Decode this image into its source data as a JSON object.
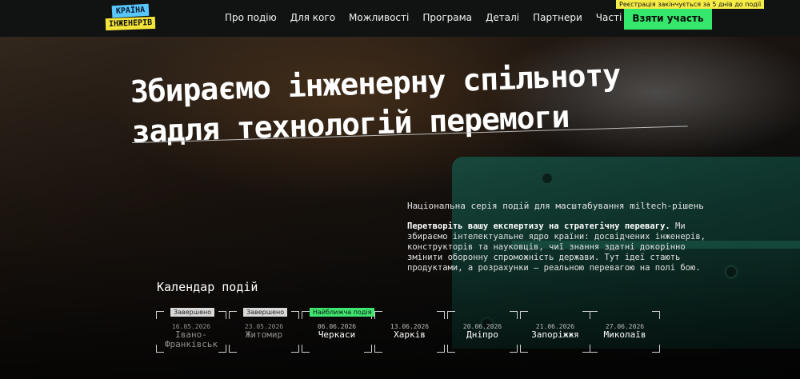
{
  "header": {
    "logo_line1": "КРАЇНА",
    "logo_line2": "ІНЖЕНЕРІВ",
    "nav": [
      "Про подію",
      "Для кого",
      "Можливості",
      "Програма",
      "Деталі",
      "Партнери",
      "Часті питання"
    ],
    "cta_label": "Взяти участь",
    "cta_tip": "Реєстрація закінчується за 5 днів до події"
  },
  "hero": {
    "title_line1": "Збираємо інженерну спільноту",
    "title_line2": "задля технологій перемоги",
    "subtitle": "Національна серія подій для масштабування miltech-рішень",
    "desc_bold": "Перетворіть вашу експертизу на стратегічну перевагу.",
    "desc_rest": " Ми збираємо інтелектуальне ядро країни: досвідчених інженерів, конструкторів та науковців, чиї знання здатні докорінно змінити оборонну спроможність держави. Тут ідеї стають продуктами, а розрахунки – реальною перевагою на полі бою."
  },
  "calendar": {
    "title": "Календар подій",
    "events": [
      {
        "badge": "Завершено",
        "date": "16.05.2026",
        "city": "Івано-Франківськ",
        "status": "done"
      },
      {
        "badge": "Завершено",
        "date": "23.05.2026",
        "city": "Житомир",
        "status": "done"
      },
      {
        "badge": "Найближча подія",
        "date": "06.06.2026",
        "city": "Черкаси",
        "status": "next"
      },
      {
        "badge": "",
        "date": "13.06.2026",
        "city": "Харків",
        "status": "upcoming"
      },
      {
        "badge": "",
        "date": "20.06.2026",
        "city": "Дніпро",
        "status": "upcoming"
      },
      {
        "badge": "",
        "date": "21.06.2026",
        "city": "Запоріжжя",
        "status": "upcoming"
      },
      {
        "badge": "",
        "date": "27.06.2026",
        "city": "Миколаїв",
        "status": "upcoming"
      }
    ]
  },
  "colors": {
    "accent": "#35e86b",
    "tip": "#f6ec47",
    "logo_blue": "#58c7ff",
    "logo_yellow": "#f3e43a"
  }
}
